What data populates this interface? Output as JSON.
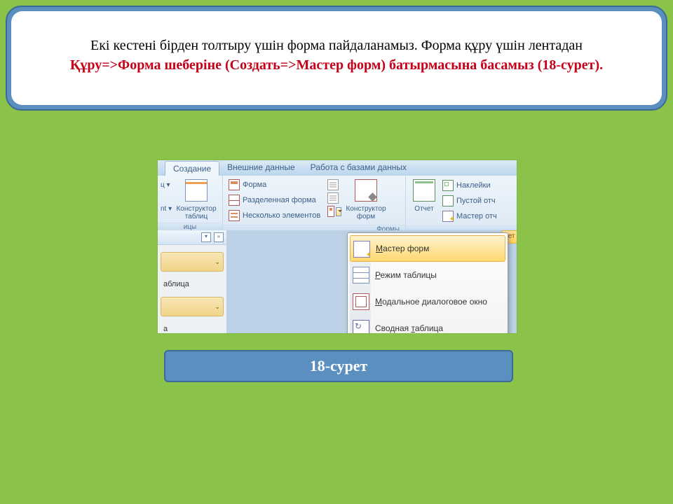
{
  "instruction": {
    "line1": "Екі кестені бірден толтыру үшін форма пайдаланамыз. Форма құру үшін лентадан",
    "line2": "Құру=>Форма шеберіне (Создать=>Мастер форм) батырмасына басамыз (18-сурет)."
  },
  "caption": "18-сурет",
  "tabs": {
    "create": "Создание",
    "external": "Внешние данные",
    "dbtools": "Работа с базами данных"
  },
  "groups": {
    "tables": {
      "label": "ицы",
      "partial_left": "ц ▾",
      "partial_nt": "nt ▾",
      "designer": "Конструктор\nтаблиц"
    },
    "forms": {
      "label": "Формы",
      "form": "Форма",
      "split": "Разделенная форма",
      "multi": "Несколько элементов",
      "ctor": "Конструктор\nформ"
    },
    "reports": {
      "report": "Отчет",
      "labels": "Наклейки",
      "blank": "Пустой отч",
      "wizard": "Мастер отч"
    }
  },
  "nav": {
    "item1": "аблица",
    "item2": "а"
  },
  "orange_tab": "чет",
  "menu": {
    "master": "астер форм",
    "datasheet": "ежим таблицы",
    "modal": "одальное диалоговое окно",
    "pivot": "аблица",
    "pivot_prefix": "Сводная "
  }
}
